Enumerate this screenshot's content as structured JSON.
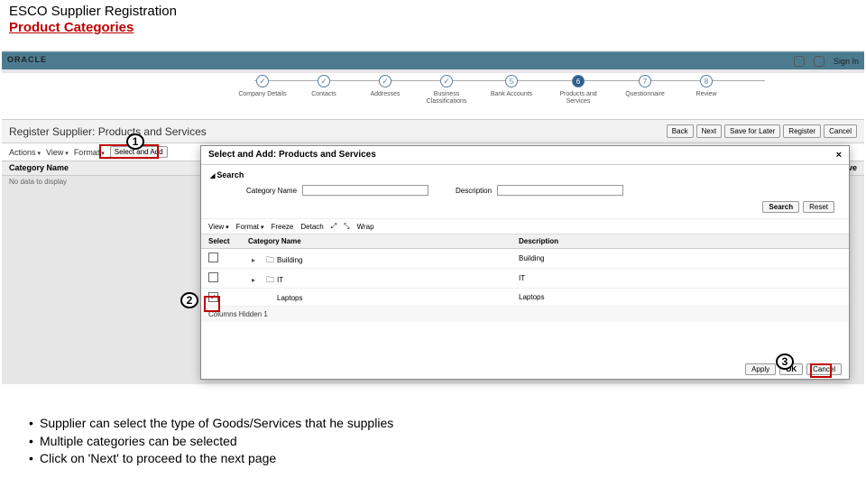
{
  "slide": {
    "title": "ESCO Supplier Registration",
    "subtitle": "Product Categories"
  },
  "appbar": {
    "brand": "ORACLE",
    "signin": "Sign In"
  },
  "stepper": [
    {
      "num": "",
      "state": "done",
      "label": "Company Details"
    },
    {
      "num": "",
      "state": "done",
      "label": "Contacts"
    },
    {
      "num": "",
      "state": "done",
      "label": "Addresses"
    },
    {
      "num": "",
      "state": "done",
      "label": "Business Classifications"
    },
    {
      "num": "5",
      "state": "",
      "label": "Bank Accounts"
    },
    {
      "num": "6",
      "state": "active",
      "label": "Products and Services"
    },
    {
      "num": "7",
      "state": "",
      "label": "Questionnaire"
    },
    {
      "num": "8",
      "state": "",
      "label": "Review"
    }
  ],
  "page": {
    "title": "Register Supplier: Products and Services",
    "buttons": {
      "back": "Back",
      "next": "Next",
      "save": "Save for Later",
      "register": "Register",
      "cancel": "Cancel"
    }
  },
  "actions": {
    "actions": "Actions",
    "view": "View",
    "format": "Format",
    "select_add": "Select and Add"
  },
  "grid": {
    "col_category": "Category Name",
    "col_remove": "Remove",
    "empty": "No data to display"
  },
  "modal": {
    "title": "Select and Add: Products and Services",
    "search": "Search",
    "fields": {
      "category": "Category Name",
      "description": "Description"
    },
    "search_btn": "Search",
    "reset_btn": "Reset",
    "toolbar": {
      "view": "View",
      "format": "Format",
      "freeze": "Freeze",
      "detach": "Detach",
      "wrap": "Wrap"
    },
    "cols": {
      "select": "Select",
      "name": "Category Name",
      "desc": "Description"
    },
    "rows": [
      {
        "checked": false,
        "name": "Building",
        "desc": "Building"
      },
      {
        "checked": false,
        "name": "IT",
        "desc": "IT"
      },
      {
        "checked": true,
        "name": "Laptops",
        "desc": "Laptops"
      }
    ],
    "cols_hidden": "Columns Hidden 1",
    "footer": {
      "apply": "Apply",
      "ok": "OK",
      "cancel": "Cancel"
    }
  },
  "callouts": {
    "c1": "1",
    "c2": "2",
    "c3": "3"
  },
  "notes": [
    "Supplier can select the type of Goods/Services that he supplies",
    "Multiple categories can be selected",
    "Click on 'Next' to proceed to the next page"
  ]
}
